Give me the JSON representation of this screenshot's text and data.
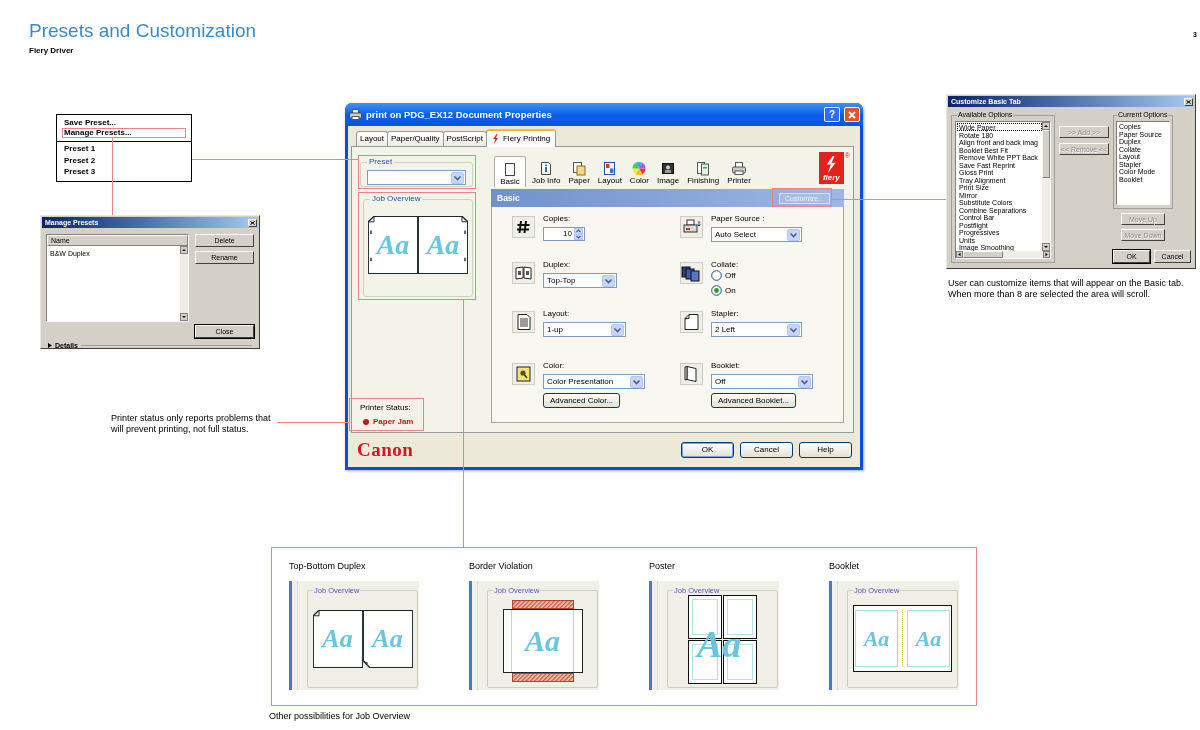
{
  "page": {
    "title": "Presets and Customization",
    "subtitle": "Fiery Driver",
    "page_number": "3"
  },
  "preset_menu": {
    "actions": [
      "Save Preset...",
      "Manage Presets..."
    ],
    "presets": [
      "Preset 1",
      "Preset 2",
      "Preset 3"
    ]
  },
  "manage_presets_dialog": {
    "title": "Manage Presets",
    "column": "Name",
    "rows": [
      "B&W Duplex"
    ],
    "buttons": [
      "Delete",
      "Rename"
    ],
    "close_button": "Close",
    "details": "Details"
  },
  "status_note": "Printer status only reports problems that will prevent printing, not full status.",
  "document_properties": {
    "title": "print on PDG_EX12 Document Properties",
    "help_button": "?",
    "tabs": [
      {
        "label": "Layout",
        "selected": false
      },
      {
        "label": "Paper/Quality",
        "selected": false
      },
      {
        "label": "PostScript",
        "selected": false
      },
      {
        "label": "Fiery Printing",
        "selected": true
      }
    ],
    "preset_label": "Preset",
    "job_overview": {
      "label": "Job Overview",
      "pages": [
        "Aa",
        "Aa"
      ]
    },
    "printer_status": {
      "label": "Printer Status:",
      "value": "Paper Jam",
      "error": true
    },
    "categories": [
      {
        "label": "Basic",
        "selected": true
      },
      {
        "label": "Job Info",
        "selected": false
      },
      {
        "label": "Paper",
        "selected": false
      },
      {
        "label": "Layout",
        "selected": false
      },
      {
        "label": "Color",
        "selected": false
      },
      {
        "label": "Image",
        "selected": false
      },
      {
        "label": "Finishing",
        "selected": false
      },
      {
        "label": "Printer",
        "selected": false
      }
    ],
    "fiery_logo": {
      "text": "fiery",
      "mark": "®"
    },
    "section": {
      "title": "Basic",
      "customize": {
        "label": "Customize...",
        "disabled": true
      }
    },
    "settings": [
      {
        "kind": "spinner",
        "label": "Copies:",
        "value": "10"
      },
      {
        "kind": "dropdown",
        "label": "Paper Source :",
        "value": "Auto Select"
      },
      {
        "kind": "dropdown",
        "label": "Duplex:",
        "value": "Top-Top"
      },
      {
        "kind": "radio",
        "label": "Collate:",
        "options": [
          {
            "label": "Off",
            "selected": false
          },
          {
            "label": "On",
            "selected": true
          }
        ]
      },
      {
        "kind": "dropdown",
        "label": "Layout:",
        "value": "1-up"
      },
      {
        "kind": "dropdown",
        "label": "Stapler:",
        "value": "2 Left"
      },
      {
        "kind": "dropdown",
        "label": "Color:",
        "value": "Color Presentation",
        "button": "Advanced Color..."
      },
      {
        "kind": "dropdown",
        "label": "Booklet:",
        "value": "Off",
        "button": "Advanced Booklet..."
      }
    ],
    "logo": "Canon",
    "buttons": [
      {
        "label": "OK",
        "default": true
      },
      {
        "label": "Cancel",
        "default": false
      },
      {
        "label": "Help",
        "default": false
      }
    ]
  },
  "customize_dialog": {
    "title": "Customize Basic Tab",
    "available": {
      "label": "Available Options",
      "items": [
        {
          "label": "Wide Paper",
          "focused": true
        },
        {
          "label": "Rotate 180",
          "focused": false
        },
        {
          "label": "Align front and back imag",
          "focused": false
        },
        {
          "label": "Booklet Best Fit",
          "focused": false
        },
        {
          "label": "Remove White PPT Back",
          "focused": false
        },
        {
          "label": "Save Fast Reprint",
          "focused": false
        },
        {
          "label": "Gloss Print",
          "focused": false
        },
        {
          "label": "Tray Alignment",
          "focused": false
        },
        {
          "label": "Print Size",
          "focused": false
        },
        {
          "label": "Mirror",
          "focused": false
        },
        {
          "label": "Substitute Colors",
          "focused": false
        },
        {
          "label": "Combine Separations",
          "focused": false
        },
        {
          "label": "Control Bar",
          "focused": false
        },
        {
          "label": "Postflight",
          "focused": false
        },
        {
          "label": "Progressives",
          "focused": false
        },
        {
          "label": "Units",
          "focused": false
        },
        {
          "label": "Image Smoothing",
          "focused": false
        }
      ]
    },
    "current": {
      "label": "Current Options",
      "items": [
        "Copies",
        "Paper Source",
        "Duplex",
        "Collate",
        "Layout",
        "Stapler",
        "Color Mode",
        "Booklet"
      ]
    },
    "transfer_buttons": [
      {
        "label": ">> Add >>",
        "disabled": true
      },
      {
        "label": "<< Remove <<",
        "disabled": true
      }
    ],
    "order_buttons": [
      {
        "label": "Move Up",
        "disabled": true
      },
      {
        "label": "Move Down",
        "disabled": true
      }
    ],
    "buttons": [
      {
        "label": "OK",
        "default": true
      },
      {
        "label": "Cancel",
        "default": false
      }
    ]
  },
  "customize_note": "User can customize items that will appear on the Basic tab. When more than 8 are selected the area will scroll.",
  "job_overview_options": {
    "items": [
      {
        "title": "Top-Bottom Duplex",
        "kind": "duplex",
        "label": "Job Overview",
        "pages": [
          "Aa",
          "Aa"
        ]
      },
      {
        "title": "Border Violation",
        "kind": "border_violation",
        "label": "Job Overview",
        "pages": [
          "Aa"
        ]
      },
      {
        "title": "Poster",
        "kind": "poster",
        "label": "Job Overview",
        "pages": [
          "Aa"
        ]
      },
      {
        "title": "Booklet",
        "kind": "booklet",
        "label": "Job Overview",
        "pages": [
          "Aa",
          "Aa"
        ]
      }
    ],
    "caption": "Other possibilities for Job Overview"
  }
}
